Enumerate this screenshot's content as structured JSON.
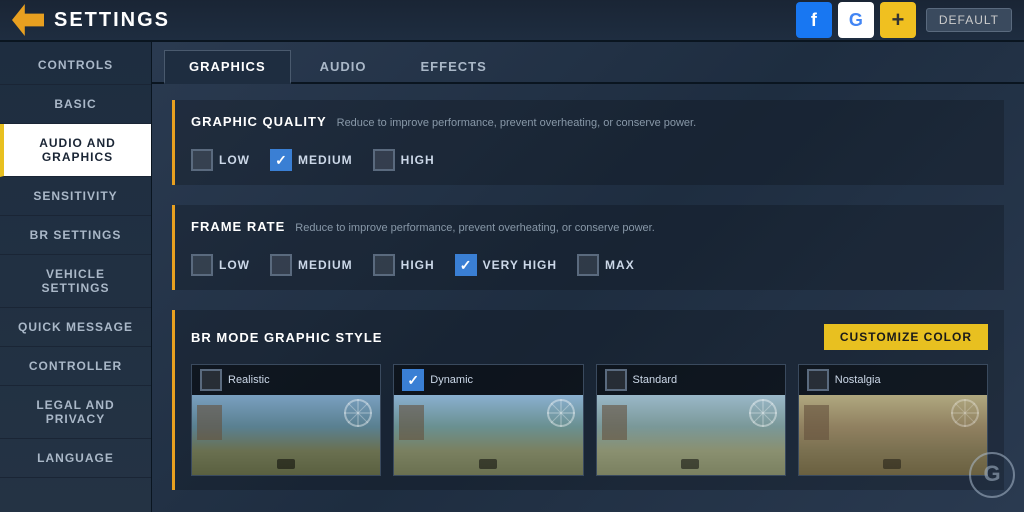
{
  "header": {
    "title": "SETTINGS",
    "back_icon": "back-arrow",
    "icons": {
      "facebook_label": "f",
      "google_label": "G",
      "plus_label": "+",
      "default_label": "DEFAULT"
    }
  },
  "sidebar": {
    "items": [
      {
        "id": "controls",
        "label": "CONTROLS",
        "active": false
      },
      {
        "id": "basic",
        "label": "BASIC",
        "active": false
      },
      {
        "id": "audio-and-graphics",
        "label": "AUDIO AND GRAPHICS",
        "active": true
      },
      {
        "id": "sensitivity",
        "label": "SENSITIVITY",
        "active": false
      },
      {
        "id": "br-settings",
        "label": "BR SETTINGS",
        "active": false
      },
      {
        "id": "vehicle-settings",
        "label": "VEHICLE SETTINGS",
        "active": false
      },
      {
        "id": "quick-message",
        "label": "QUICK MESSAGE",
        "active": false
      },
      {
        "id": "controller",
        "label": "CONTROLLER",
        "active": false
      },
      {
        "id": "legal-and-privacy",
        "label": "LEGAL AND PRIVACY",
        "active": false
      },
      {
        "id": "language",
        "label": "LANGUAGE",
        "active": false
      }
    ]
  },
  "tabs": [
    {
      "id": "graphics",
      "label": "GRAPHICS",
      "active": true
    },
    {
      "id": "audio",
      "label": "AUDIO",
      "active": false
    },
    {
      "id": "effects",
      "label": "EFFECTS",
      "active": false
    }
  ],
  "graphic_quality": {
    "title": "GRAPHIC QUALITY",
    "subtitle": "Reduce to improve performance, prevent overheating, or conserve power.",
    "options": [
      {
        "id": "low",
        "label": "LOW",
        "checked": false
      },
      {
        "id": "medium",
        "label": "MEDIUM",
        "checked": true
      },
      {
        "id": "high",
        "label": "HIGH",
        "checked": false
      }
    ]
  },
  "frame_rate": {
    "title": "FRAME RATE",
    "subtitle": "Reduce to improve performance, prevent overheating, or conserve power.",
    "options": [
      {
        "id": "low",
        "label": "LOW",
        "checked": false
      },
      {
        "id": "medium",
        "label": "MEDIUM",
        "checked": false
      },
      {
        "id": "high",
        "label": "HIGH",
        "checked": false
      },
      {
        "id": "very-high",
        "label": "VERY HIGH",
        "checked": true
      },
      {
        "id": "max",
        "label": "MAX",
        "checked": false
      }
    ]
  },
  "br_mode": {
    "title": "BR MODE GRAPHIC STYLE",
    "customize_label": "CUSTOMIZE COLOR",
    "styles": [
      {
        "id": "realistic",
        "label": "Realistic",
        "checked": false
      },
      {
        "id": "dynamic",
        "label": "Dynamic",
        "checked": true
      },
      {
        "id": "standard",
        "label": "Standard",
        "checked": false
      },
      {
        "id": "nostalgia",
        "label": "Nostalgia",
        "checked": false
      }
    ]
  }
}
